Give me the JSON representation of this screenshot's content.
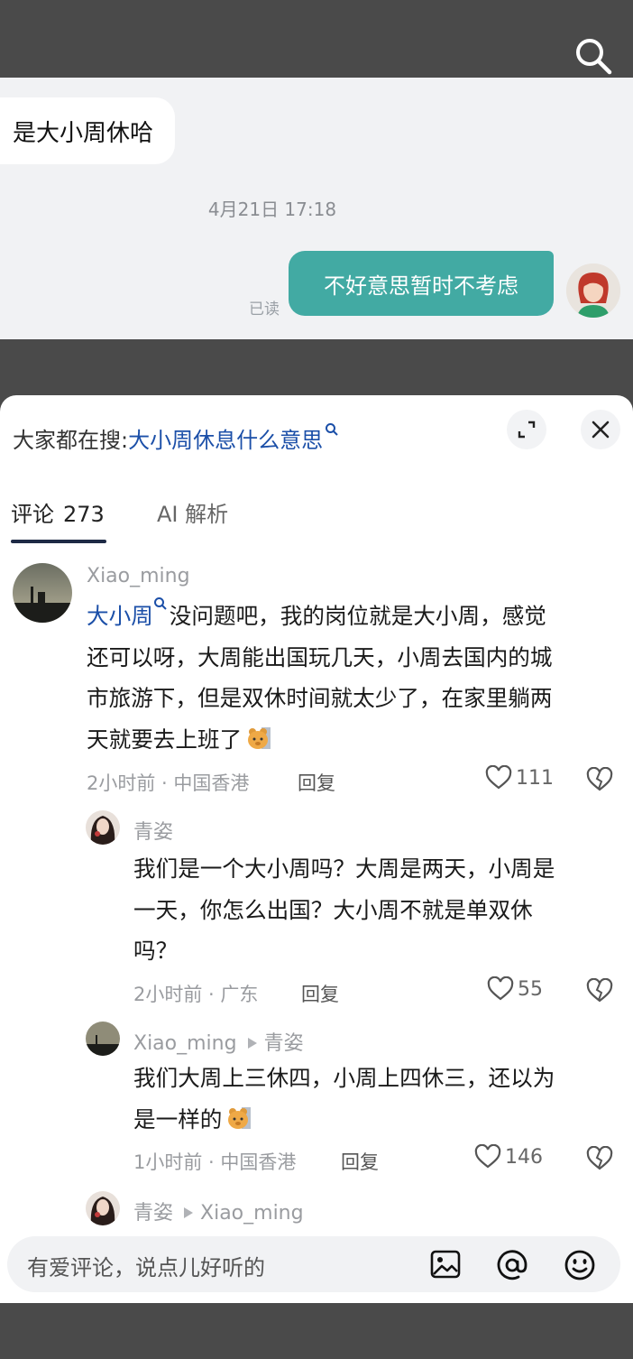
{
  "chat": {
    "incoming_message": "是大小周休哈",
    "timestamp": "4月21日 17:18",
    "outgoing_message": "不好意思暂时不考虑",
    "read_status": "已读"
  },
  "panel": {
    "search_prefix": "大家都在搜:",
    "search_term": "大小周休息什么意思",
    "tabs": [
      {
        "label": "评论",
        "count": "273"
      },
      {
        "label": "AI 解析"
      }
    ]
  },
  "comments": [
    {
      "user": "Xiao_ming",
      "keyword": "大小周",
      "lines": [
        "没问题吧，我的岗位就是大小周，感觉",
        "还可以呀，大周能出国玩几天，小周去国内的城",
        "市旅游下，但是双休时间就太少了，在家里躺两",
        "天就要去上班了"
      ],
      "time_location": "2小时前 · 中国香港",
      "reply_label": "回复",
      "likes": "111"
    },
    {
      "user": "青姿",
      "lines": [
        "我们是一个大小周吗？大周是两天，小周是",
        "一天，你怎么出国？大小周不就是单双休",
        "吗？"
      ],
      "time_location": "2小时前 · 广东",
      "reply_label": "回复",
      "likes": "55"
    },
    {
      "user": "Xiao_ming",
      "reply_to": "青姿",
      "lines": [
        "我们大周上三休四，小周上四休三，还以为",
        "是一样的"
      ],
      "time_location": "1小时前 · 中国香港",
      "reply_label": "回复",
      "likes": "146"
    },
    {
      "user": "青姿",
      "reply_to": "Xiao_ming"
    }
  ],
  "input": {
    "placeholder": "有爱评论，说点儿好听的"
  },
  "icons": [
    "search-icon",
    "expand-icon",
    "close-icon",
    "heart-icon",
    "dislike-icon",
    "image-icon",
    "at-icon",
    "emoji-icon"
  ]
}
